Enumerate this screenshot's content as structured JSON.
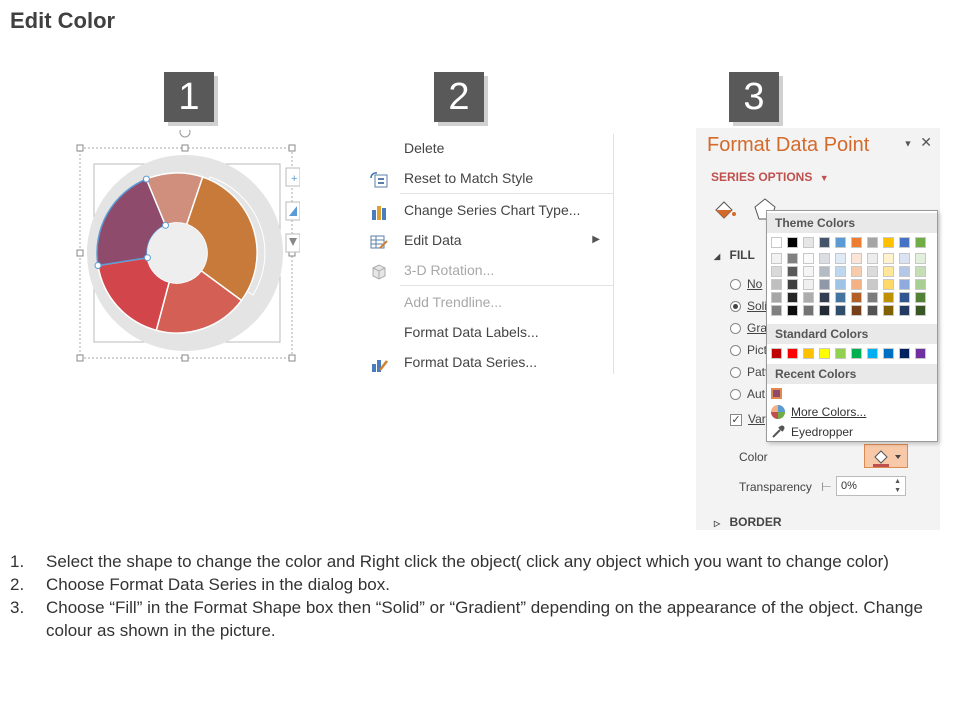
{
  "page": {
    "title": "Edit Color"
  },
  "steps": [
    "1",
    "2",
    "3"
  ],
  "context_menu": {
    "items": [
      {
        "label": "Delete",
        "icon": "none",
        "disabled": false
      },
      {
        "label": "Reset to Match Style",
        "icon": "reset-style-icon",
        "disabled": false
      },
      {
        "label": "Change Series Chart Type...",
        "icon": "bar-chart-icon",
        "disabled": false
      },
      {
        "label": "Edit Data",
        "icon": "table-edit-icon",
        "disabled": false,
        "submenu": true
      },
      {
        "label": "3-D Rotation...",
        "icon": "cube-icon",
        "disabled": true
      },
      {
        "label": "Add Trendline...",
        "icon": "none",
        "disabled": true
      },
      {
        "label": "Format Data Labels...",
        "icon": "none",
        "disabled": false
      },
      {
        "label": "Format Data Series...",
        "icon": "format-series-icon",
        "disabled": false
      }
    ]
  },
  "format_pane": {
    "title": "Format Data Point",
    "series_options": "SERIES OPTIONS",
    "fill_heading": "FILL",
    "fill_options": [
      "No",
      "Soli",
      "Gra",
      "Pict",
      "Patt",
      "Aut"
    ],
    "vary_label": "Vary",
    "color_label": "Color",
    "transparency_label": "Transparency",
    "transparency_value": "0%",
    "border_heading": "BORDER"
  },
  "color_popup": {
    "theme_heading": "Theme Colors",
    "standard_heading": "Standard Colors",
    "recent_heading": "Recent Colors",
    "more_colors": "More Colors...",
    "eyedropper": "Eyedropper",
    "theme_top": [
      "#ffffff",
      "#000000",
      "#e7e6e6",
      "#44546a",
      "#5b9bd5",
      "#ed7d31",
      "#a5a5a5",
      "#ffc000",
      "#4472c4",
      "#70ad47"
    ],
    "standard": [
      "#c00000",
      "#ff0000",
      "#ffc000",
      "#ffff00",
      "#92d050",
      "#00b050",
      "#00b0f0",
      "#0070c0",
      "#002060",
      "#7030a0"
    ],
    "recent": [
      "#8e4b6b"
    ]
  },
  "instructions": [
    {
      "num": "1.",
      "text": "Select the shape to change the color and Right click the object( click any object which you want to change color)"
    },
    {
      "num": "2.",
      "text": "Choose Format Data Series in the dialog box."
    },
    {
      "num": "3.",
      "text": "Choose “Fill” in the Format Shape box then “Solid” or “Gradient” depending on the appearance of the object. Change colour as shown in the picture."
    }
  ],
  "colors": {
    "accent": "#d46a2a",
    "badge": "#595959"
  }
}
